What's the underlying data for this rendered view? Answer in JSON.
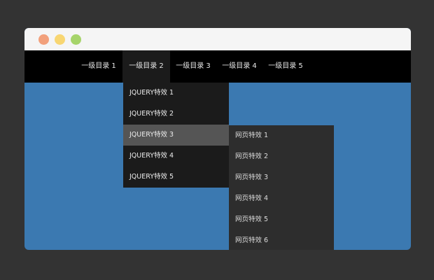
{
  "colors": {
    "background": "#333333",
    "titlebar": "#f5f5f5",
    "content": "#3b79b1",
    "navbar": "#000000",
    "submenu": "#1b1b1b",
    "submenu_hover": "#555555",
    "subsubmenu": "#2d2d2d",
    "dot_close": "#f2a07b",
    "dot_minimize": "#f8d672",
    "dot_maximize": "#a6d46a"
  },
  "nav": {
    "items": [
      {
        "label": "一级目录 1"
      },
      {
        "label": "一级目录 2"
      },
      {
        "label": "一级目录 3"
      },
      {
        "label": "一级目录 4"
      },
      {
        "label": "一级目录 5"
      }
    ],
    "active_index": 1
  },
  "submenu": {
    "items": [
      {
        "label": "JQUERY特效 1"
      },
      {
        "label": "JQUERY特效 2"
      },
      {
        "label": "JQUERY特效 3"
      },
      {
        "label": "JQUERY特效 4"
      },
      {
        "label": "JQUERY特效 5"
      }
    ],
    "active_index": 2
  },
  "subsubmenu": {
    "items": [
      {
        "label": "网页特效 1"
      },
      {
        "label": "网页特效 2"
      },
      {
        "label": "网页特效 3"
      },
      {
        "label": "网页特效 4"
      },
      {
        "label": "网页特效 5"
      },
      {
        "label": "网页特效 6"
      }
    ]
  }
}
